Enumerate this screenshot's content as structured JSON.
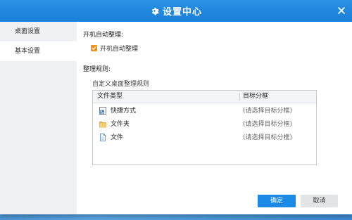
{
  "window": {
    "title": "设置中心",
    "accent_color": "#1a7fd8"
  },
  "sidebar": {
    "items": [
      {
        "label": "桌面设置"
      },
      {
        "label": "基本设置",
        "selected": true
      }
    ]
  },
  "autostart": {
    "section_label": "开机自动整理:",
    "checkbox_label": "开机自动整理",
    "checked": true,
    "check_color": "#f5921e"
  },
  "rules": {
    "section_label": "整理规则:",
    "custom_label": "自定义桌面整理规则",
    "columns": [
      "文件类型",
      "目标分框"
    ],
    "rows": [
      {
        "icon": "shortcut-icon",
        "type": "快捷方式",
        "target": "(请选择目标分框)"
      },
      {
        "icon": "folder-icon",
        "type": "文件夹",
        "target": "(请选择目标分框)"
      },
      {
        "icon": "file-icon",
        "type": "文件",
        "target": "(请选择目标分框)"
      }
    ]
  },
  "buttons": {
    "ok_label": "确定",
    "cancel_label": "取消"
  }
}
